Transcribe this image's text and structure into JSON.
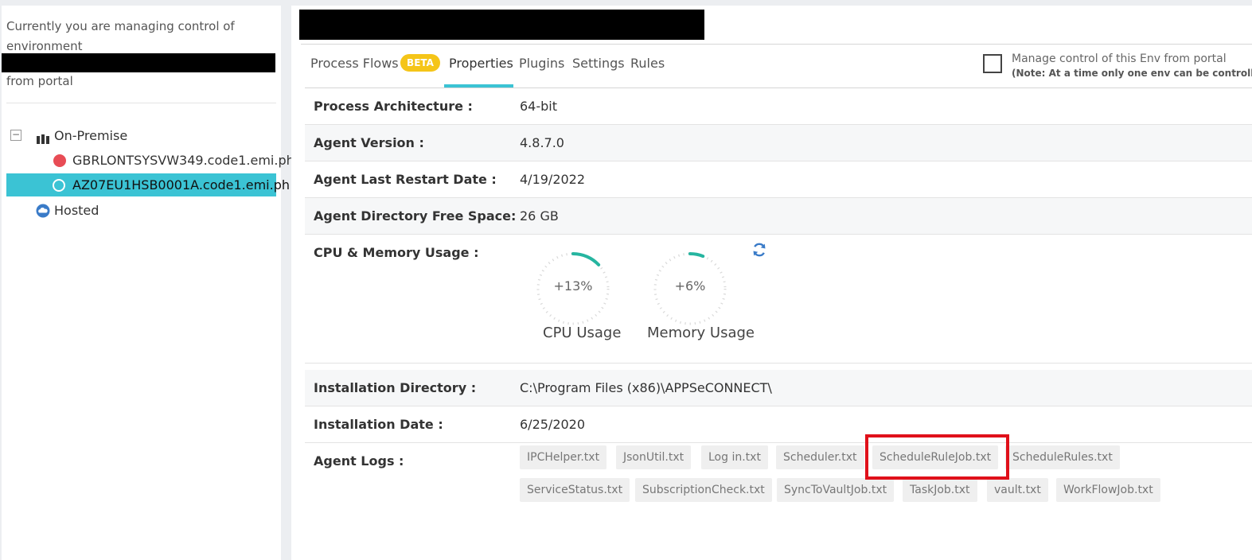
{
  "left_panel": {
    "message": "Currently you are managing control of environment",
    "message_suffix": "from portal",
    "tree": {
      "on_premise_label": "On-Premise",
      "toggle_symbol": "−",
      "servers": [
        {
          "name": "GBRLONTSYSVW349.code1.emi.ph",
          "status_color": "#e84c55"
        },
        {
          "name": "AZ07EU1HSB0001A.code1.emi.ph",
          "status_color": "#ffffff"
        }
      ],
      "hosted_label": "Hosted"
    }
  },
  "tabs": [
    {
      "label": "Process Flows"
    },
    {
      "label": "Properties"
    },
    {
      "label": "Plugins"
    },
    {
      "label": "Settings"
    },
    {
      "label": "Rules"
    }
  ],
  "beta_badge": "BETA",
  "active_tab": "Properties",
  "manage_control": {
    "label": "Manage control of this Env from portal",
    "note": "(Note: At a time only one env can be controlled)",
    "checked": false
  },
  "properties": {
    "process_architecture": {
      "label": "Process Architecture :",
      "value": "64-bit"
    },
    "agent_version": {
      "label": "Agent Version :",
      "value": "4.8.7.0"
    },
    "agent_last_restart": {
      "label": "Agent Last Restart Date :",
      "value": "4/19/2022"
    },
    "agent_free_space": {
      "label": "Agent Directory Free Space:",
      "value": "26 GB"
    },
    "cpu_memory": {
      "label": "CPU & Memory Usage :"
    },
    "installation_directory": {
      "label": "Installation Directory :",
      "value": "C:\\Program Files (x86)\\APPSeCONNECT\\"
    },
    "installation_date": {
      "label": "Installation Date :",
      "value": "6/25/2020"
    },
    "agent_logs": {
      "label": "Agent Logs :"
    }
  },
  "gauges": {
    "cpu": {
      "text": "+13%",
      "caption": "CPU Usage",
      "percent": 13
    },
    "memory": {
      "text": "+6%",
      "caption": "Memory Usage",
      "percent": 6
    }
  },
  "log_files": [
    "IPCHelper.txt",
    "JsonUtil.txt",
    "Log in.txt",
    "Scheduler.txt",
    "ScheduleRuleJob.txt",
    "ScheduleRules.txt",
    "ServiceStatus.txt",
    "SubscriptionCheck.txt",
    "SyncToVaultJob.txt",
    "TaskJob.txt",
    "vault.txt",
    "WorkFlowJob.txt"
  ],
  "highlighted_log": "ScheduleRuleJob.txt",
  "colors": {
    "accent": "#3bc3d4",
    "beta": "#f5c518",
    "highlight": "#e0101a",
    "gauge": "#26b5a0"
  }
}
